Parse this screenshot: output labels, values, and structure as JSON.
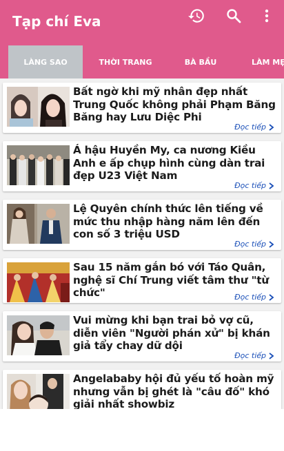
{
  "app": {
    "title": "Tạp chí Eva"
  },
  "toolbar": {
    "icons": [
      "history-icon",
      "search-icon",
      "more-vert-icon"
    ]
  },
  "tabs": [
    {
      "label": "LÀNG SAO",
      "active": true
    },
    {
      "label": "THỜI TRANG",
      "active": false
    },
    {
      "label": "BÀ BẦU",
      "active": false
    },
    {
      "label": "LÀM MẸ",
      "active": false
    }
  ],
  "articles": [
    {
      "title": "Bất ngờ khi mỹ nhân đẹp nhất Trung Quốc không phải Phạm Băng Băng hay Lưu Diệc Phi",
      "more": "Đọc tiếp"
    },
    {
      "title": "Á hậu Huyền My, ca nương Kiều Anh e ấp chụp hình cùng dàn trai đẹp U23 Việt Nam",
      "more": "Đọc tiếp"
    },
    {
      "title": "Lệ Quyên chính thức lên tiếng về mức thu nhập hàng năm lên đến con số 3 triệu USD",
      "more": "Đọc tiếp"
    },
    {
      "title": "Sau 15 năm gắn bó với Táo Quân, nghệ sĩ Chí Trung viết tâm thư \"từ chức\"",
      "more": "Đọc tiếp"
    },
    {
      "title": "Vui mừng khi bạn trai bỏ vợ cũ, diễn viên \"Người phán xử\" bị khán giả tẩy chay dữ dội",
      "more": "Đọc tiếp"
    },
    {
      "title": "Angelababy hội đủ yếu tố hoàn mỹ nhưng vẫn bị ghét là \"câu đố\" khó giải nhất showbiz",
      "more": ""
    }
  ],
  "colors": {
    "appbar": "#e05a8c",
    "active_tab": "#bfc4c8",
    "link": "#1a4fb8"
  }
}
